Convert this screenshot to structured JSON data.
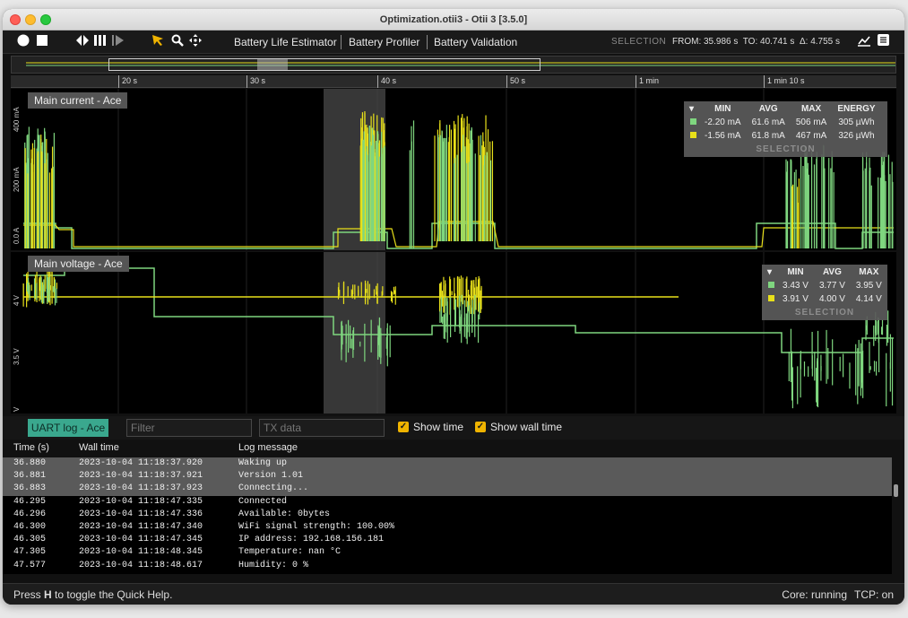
{
  "window": {
    "title": "Optimization.otii3 - Otii 3 [3.5.0]"
  },
  "toolbar": {
    "menu": [
      "Battery Life Estimator",
      "Battery Profiler",
      "Battery Validation"
    ],
    "selection_label": "SELECTION",
    "selection_from": "FROM: 35.986 s",
    "selection_to": "TO: 40.741 s",
    "selection_delta": "Δ: 4.755 s"
  },
  "timeline": {
    "ticks": [
      "20 s",
      "30 s",
      "40 s",
      "50 s",
      "1 min",
      "1 min 10 s"
    ]
  },
  "colors": {
    "green": "#7fd67f",
    "yellow": "#e8e01a",
    "accent": "#3aa88e",
    "checkbox": "#f0b400"
  },
  "current_plot": {
    "title": "Main current - Ace",
    "y_ticks": [
      "400 mA",
      "200 mA",
      "0.0 A"
    ],
    "stats": {
      "headers": [
        "MIN",
        "AVG",
        "MAX",
        "ENERGY"
      ],
      "rows": [
        {
          "color": "green",
          "min": "-2.20 mA",
          "avg": "61.6 mA",
          "max": "506 mA",
          "energy": "305 µWh"
        },
        {
          "color": "yellow",
          "min": "-1.56 mA",
          "avg": "61.8 mA",
          "max": "467 mA",
          "energy": "326 µWh"
        }
      ],
      "footer": "SELECTION"
    }
  },
  "voltage_plot": {
    "title": "Main voltage - Ace",
    "y_ticks": [
      "4 V",
      "3.5 V",
      "V"
    ],
    "stats": {
      "headers": [
        "MIN",
        "AVG",
        "MAX"
      ],
      "rows": [
        {
          "color": "green",
          "min": "3.43 V",
          "avg": "3.77 V",
          "max": "3.95 V"
        },
        {
          "color": "yellow",
          "min": "3.91 V",
          "avg": "4.00 V",
          "max": "4.14 V"
        }
      ],
      "footer": "SELECTION"
    }
  },
  "uart": {
    "tab_label": "UART log - Ace",
    "filter_placeholder": "Filter",
    "tx_placeholder": "TX data",
    "show_time_label": "Show time",
    "show_wall_time_label": "Show wall time",
    "columns": [
      "Time (s)",
      "Wall time",
      "Log message"
    ],
    "rows": [
      {
        "t": "36.880",
        "w": "2023-10-04 11:18:37.920",
        "m": "Waking up",
        "selected": true
      },
      {
        "t": "36.881",
        "w": "2023-10-04 11:18:37.921",
        "m": "Version 1.01",
        "selected": true
      },
      {
        "t": "36.883",
        "w": "2023-10-04 11:18:37.923",
        "m": "Connecting...",
        "selected": true
      },
      {
        "t": "46.295",
        "w": "2023-10-04 11:18:47.335",
        "m": "Connected",
        "selected": false
      },
      {
        "t": "46.296",
        "w": "2023-10-04 11:18:47.336",
        "m": "Available: 0bytes",
        "selected": false
      },
      {
        "t": "46.300",
        "w": "2023-10-04 11:18:47.340",
        "m": "WiFi signal strength: 100.00%",
        "selected": false
      },
      {
        "t": "46.305",
        "w": "2023-10-04 11:18:47.345",
        "m": "IP address: 192.168.156.181",
        "selected": false
      },
      {
        "t": "47.305",
        "w": "2023-10-04 11:18:48.345",
        "m": "Temperature: nan °C",
        "selected": false
      },
      {
        "t": "47.577",
        "w": "2023-10-04 11:18:48.617",
        "m": "Humidity: 0 %",
        "selected": false
      }
    ]
  },
  "statusbar": {
    "help_prefix": "Press ",
    "help_key": "H",
    "help_suffix": " to toggle the Quick Help.",
    "core": "Core: running",
    "tcp": "TCP: on"
  }
}
